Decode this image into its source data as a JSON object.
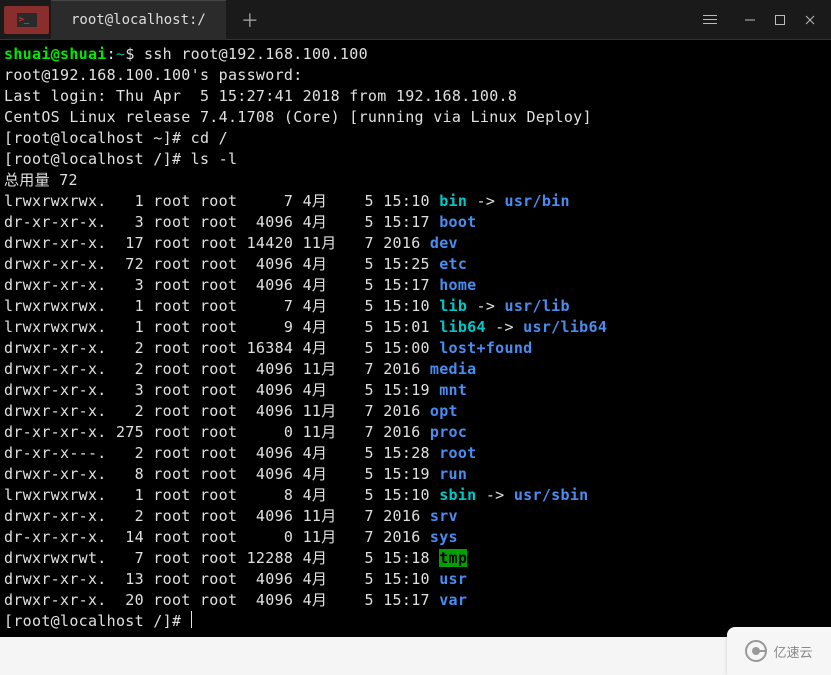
{
  "tab": {
    "title": "root@localhost:/"
  },
  "session": {
    "local_user": "shuai",
    "local_host": "shuai",
    "local_path": "~",
    "ssh_cmd": "ssh root@192.168.100.100",
    "password_prompt": "root@192.168.100.100's password:",
    "last_login": "Last login: Thu Apr  5 15:27:41 2018 from 192.168.100.8",
    "release": "CentOS Linux release 7.4.1708 (Core) [running via Linux Deploy]",
    "prompt1_user": "root@localhost",
    "prompt1_path": "~",
    "prompt1_cmd": "cd /",
    "prompt2_user": "root@localhost",
    "prompt2_path": "/",
    "prompt2_cmd": "ls -l",
    "total": "总用量 72",
    "prompt3_user": "root@localhost",
    "prompt3_path": "/"
  },
  "listing": [
    {
      "perm": "lrwxrwxrwx.",
      "links": "  1",
      "owner": "root",
      "group": "root",
      "size": "    7",
      "month": "4月",
      "day": "   5",
      "time": "15:10",
      "name": "bin",
      "type": "cyan",
      "arrow": " -> ",
      "target": "usr/bin",
      "ttype": "blue"
    },
    {
      "perm": "dr-xr-xr-x.",
      "links": "  3",
      "owner": "root",
      "group": "root",
      "size": " 4096",
      "month": "4月",
      "day": "   5",
      "time": "15:17",
      "name": "boot",
      "type": "blue"
    },
    {
      "perm": "drwxr-xr-x.",
      "links": " 17",
      "owner": "root",
      "group": "root",
      "size": "14420",
      "month": "11月",
      "day": "  7",
      "time": "2016",
      "name": "dev",
      "type": "blue"
    },
    {
      "perm": "drwxr-xr-x.",
      "links": " 72",
      "owner": "root",
      "group": "root",
      "size": " 4096",
      "month": "4月",
      "day": "   5",
      "time": "15:25",
      "name": "etc",
      "type": "blue"
    },
    {
      "perm": "drwxr-xr-x.",
      "links": "  3",
      "owner": "root",
      "group": "root",
      "size": " 4096",
      "month": "4月",
      "day": "   5",
      "time": "15:17",
      "name": "home",
      "type": "blue"
    },
    {
      "perm": "lrwxrwxrwx.",
      "links": "  1",
      "owner": "root",
      "group": "root",
      "size": "    7",
      "month": "4月",
      "day": "   5",
      "time": "15:10",
      "name": "lib",
      "type": "cyan",
      "arrow": " -> ",
      "target": "usr/lib",
      "ttype": "blue"
    },
    {
      "perm": "lrwxrwxrwx.",
      "links": "  1",
      "owner": "root",
      "group": "root",
      "size": "    9",
      "month": "4月",
      "day": "   5",
      "time": "15:01",
      "name": "lib64",
      "type": "cyan",
      "arrow": " -> ",
      "target": "usr/lib64",
      "ttype": "blue"
    },
    {
      "perm": "drwxr-xr-x.",
      "links": "  2",
      "owner": "root",
      "group": "root",
      "size": "16384",
      "month": "4月",
      "day": "   5",
      "time": "15:00",
      "name": "lost+found",
      "type": "blue"
    },
    {
      "perm": "drwxr-xr-x.",
      "links": "  2",
      "owner": "root",
      "group": "root",
      "size": " 4096",
      "month": "11月",
      "day": "  7",
      "time": "2016",
      "name": "media",
      "type": "blue"
    },
    {
      "perm": "drwxr-xr-x.",
      "links": "  3",
      "owner": "root",
      "group": "root",
      "size": " 4096",
      "month": "4月",
      "day": "   5",
      "time": "15:19",
      "name": "mnt",
      "type": "blue"
    },
    {
      "perm": "drwxr-xr-x.",
      "links": "  2",
      "owner": "root",
      "group": "root",
      "size": " 4096",
      "month": "11月",
      "day": "  7",
      "time": "2016",
      "name": "opt",
      "type": "blue"
    },
    {
      "perm": "dr-xr-xr-x.",
      "links": "275",
      "owner": "root",
      "group": "root",
      "size": "    0",
      "month": "11月",
      "day": "  7",
      "time": "2016",
      "name": "proc",
      "type": "blue"
    },
    {
      "perm": "dr-xr-x---.",
      "links": "  2",
      "owner": "root",
      "group": "root",
      "size": " 4096",
      "month": "4月",
      "day": "   5",
      "time": "15:28",
      "name": "root",
      "type": "blue"
    },
    {
      "perm": "drwxr-xr-x.",
      "links": "  8",
      "owner": "root",
      "group": "root",
      "size": " 4096",
      "month": "4月",
      "day": "   5",
      "time": "15:19",
      "name": "run",
      "type": "blue"
    },
    {
      "perm": "lrwxrwxrwx.",
      "links": "  1",
      "owner": "root",
      "group": "root",
      "size": "    8",
      "month": "4月",
      "day": "   5",
      "time": "15:10",
      "name": "sbin",
      "type": "cyan",
      "arrow": " -> ",
      "target": "usr/sbin",
      "ttype": "blue"
    },
    {
      "perm": "drwxr-xr-x.",
      "links": "  2",
      "owner": "root",
      "group": "root",
      "size": " 4096",
      "month": "11月",
      "day": "  7",
      "time": "2016",
      "name": "srv",
      "type": "blue"
    },
    {
      "perm": "dr-xr-xr-x.",
      "links": " 14",
      "owner": "root",
      "group": "root",
      "size": "    0",
      "month": "11月",
      "day": "  7",
      "time": "2016",
      "name": "sys",
      "type": "blue"
    },
    {
      "perm": "drwxrwxrwt.",
      "links": "  7",
      "owner": "root",
      "group": "root",
      "size": "12288",
      "month": "4月",
      "day": "   5",
      "time": "15:18",
      "name": "tmp",
      "type": "tmp"
    },
    {
      "perm": "drwxr-xr-x.",
      "links": " 13",
      "owner": "root",
      "group": "root",
      "size": " 4096",
      "month": "4月",
      "day": "   5",
      "time": "15:10",
      "name": "usr",
      "type": "blue"
    },
    {
      "perm": "drwxr-xr-x.",
      "links": " 20",
      "owner": "root",
      "group": "root",
      "size": " 4096",
      "month": "4月",
      "day": "   5",
      "time": "15:17",
      "name": "var",
      "type": "blue"
    }
  ],
  "watermark": "亿速云"
}
